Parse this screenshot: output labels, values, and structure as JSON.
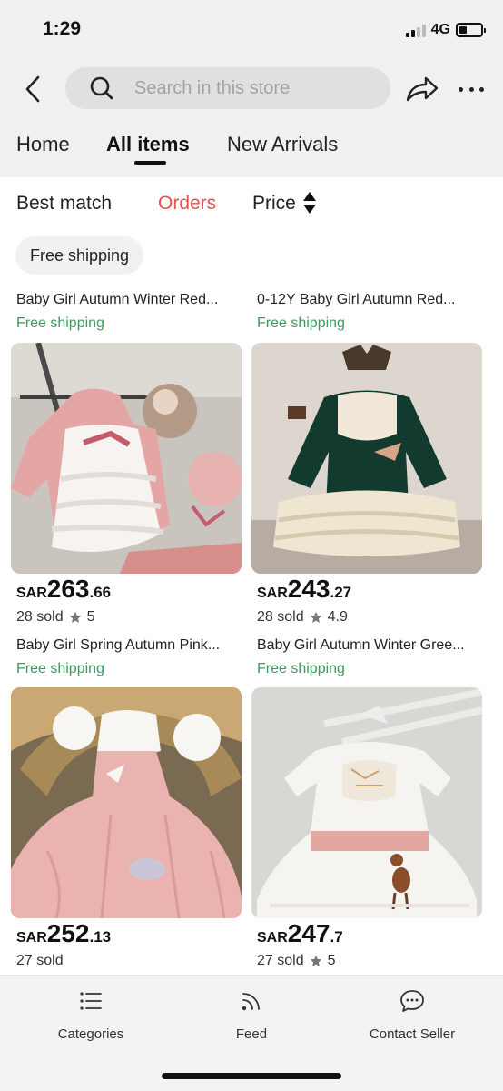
{
  "status_bar": {
    "time": "1:29",
    "network": "4G",
    "battery_level": 0.35
  },
  "topbar": {
    "search_placeholder": "Search in this store"
  },
  "tabs": [
    {
      "label": "Home",
      "active": false
    },
    {
      "label": "All items",
      "active": true
    },
    {
      "label": "New Arrivals",
      "active": false
    }
  ],
  "sort": {
    "best_match": "Best match",
    "orders": "Orders",
    "price": "Price"
  },
  "filter_chip": "Free shipping",
  "top_row": [
    {
      "title": "Baby Girl Autumn Winter Red...",
      "shipping": "Free shipping"
    },
    {
      "title": "0-12Y Baby Girl Autumn Red...",
      "shipping": "Free shipping"
    }
  ],
  "products": [
    {
      "currency": "SAR",
      "price_int": "263",
      "price_dec": ".66",
      "sold": "28 sold",
      "rating": "5",
      "title": "Baby Girl Spring Autumn Pink...",
      "shipping": "Free shipping"
    },
    {
      "currency": "SAR",
      "price_int": "243",
      "price_dec": ".27",
      "sold": "28 sold",
      "rating": "4.9",
      "title": "Baby Girl Autumn Winter Gree...",
      "shipping": "Free shipping"
    },
    {
      "currency": "SAR",
      "price_int": "252",
      "price_dec": ".13",
      "sold": "27 sold"
    },
    {
      "currency": "SAR",
      "price_int": "247",
      "price_dec": ".7",
      "sold": "27 sold",
      "rating": "5"
    }
  ],
  "bottom_nav": [
    {
      "label": "Categories",
      "icon": "list-icon"
    },
    {
      "label": "Feed",
      "icon": "feed-icon"
    },
    {
      "label": "Contact Seller",
      "icon": "chat-icon"
    }
  ],
  "colors": {
    "accent_red": "#e8504c",
    "shipping_green": "#3d9a5f",
    "header_bg": "#f0f0f0"
  }
}
